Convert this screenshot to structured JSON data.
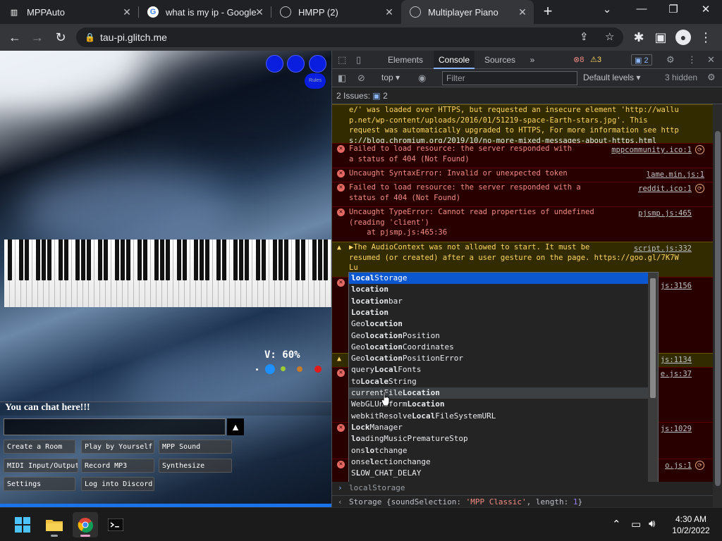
{
  "tabs": [
    {
      "title": "MPPAuto",
      "icon": "piano-icon"
    },
    {
      "title": "what is my ip - Google",
      "icon": "google-icon"
    },
    {
      "title": "HMPP (2)",
      "icon": "globe-icon"
    },
    {
      "title": "Multiplayer Piano",
      "icon": "globe-icon"
    }
  ],
  "address_bar": {
    "url": "tau-pi.glitch.me"
  },
  "app": {
    "volume": "V: 60%",
    "rules_label": "Rules",
    "chat_title": "You can chat here!!!",
    "chat_send": "▲",
    "buttons": [
      "Create a Room",
      "Play by Yourself",
      "MPP Sound",
      "MIDI Input/Output",
      "Record MP3",
      "Synthesize",
      "Settings",
      "Log into Discord"
    ]
  },
  "devtools": {
    "tabs": [
      "Elements",
      "Console",
      "Sources",
      "»"
    ],
    "error_count": "8",
    "warning_count": "3",
    "message_count": "2",
    "context": "top",
    "filter_placeholder": "Filter",
    "levels": "Default levels",
    "hidden": "3 hidden",
    "issues_label": "2 Issues:",
    "issues_count": "2",
    "messages": [
      {
        "type": "warn",
        "lines": [
          "e/' was loaded over HTTPS, but requested an insecure element 'http://wallu",
          "p.net/wp-content/uploads/2016/01/51219-space-Earth-stars.jpg'. This",
          "request was automatically upgraded to HTTPS, For more information see http",
          "s://blog.chromium.org/2019/10/no-more-mixed-messages-about-https.html"
        ],
        "source": ""
      },
      {
        "type": "err",
        "lines": [
          "Failed to load resource: the server responded with",
          "a status of 404 (Not Found)"
        ],
        "source": "mppcommunity.ico:1"
      },
      {
        "type": "err",
        "lines": [
          "Uncaught SyntaxError: Invalid or unexpected token"
        ],
        "source": "lame.min.js:1"
      },
      {
        "type": "err",
        "lines": [
          "Failed to load resource: the server responded with a",
          "status of 404 (Not Found)"
        ],
        "source": "reddit.ico:1"
      },
      {
        "type": "err",
        "lines": [
          "Uncaught TypeError: Cannot read properties of undefined",
          "(reading 'client')",
          "    at pjsmp.js:465:36"
        ],
        "source": "pjsmp.js:465"
      },
      {
        "type": "warn",
        "lines": [
          "▶The AudioContext was not allowed to start. It must be",
          "resumed (or created) after a user gesture on the page. https://goo.gl/7K7W",
          "Lu"
        ],
        "source": "script.js:332"
      },
      {
        "type": "err",
        "lines": [
          ""
        ],
        "source": "js:3156"
      },
      {
        "type": "warn",
        "lines": [
          ""
        ],
        "source": "js:1134"
      },
      {
        "type": "err",
        "lines": [
          ""
        ],
        "source": "e.js:37"
      },
      {
        "type": "err",
        "lines": [
          ""
        ],
        "source": "js:1029"
      },
      {
        "type": "err",
        "lines": [
          ""
        ],
        "source": "o.js:1"
      }
    ],
    "autocomplete": [
      {
        "bold": "local",
        "rest": "Storage"
      },
      {
        "bold": "location",
        "rest": ""
      },
      {
        "bold": "location",
        "rest": "bar"
      },
      {
        "bold": "Location",
        "rest": ""
      },
      {
        "pre": "Geo",
        "bold": "location",
        "rest": ""
      },
      {
        "pre": "Geo",
        "bold": "location",
        "rest": "Position"
      },
      {
        "pre": "Geo",
        "bold": "location",
        "rest": "Coordinates"
      },
      {
        "pre": "Geo",
        "bold": "location",
        "rest": "PositionError"
      },
      {
        "pre": "query",
        "bold": "Local",
        "rest": "Fonts"
      },
      {
        "pre": "to",
        "bold": "Locale",
        "rest": "String"
      },
      {
        "pre": "currentFile",
        "bold": "Location",
        "rest": ""
      },
      {
        "pre": "WebGLUniform",
        "bold": "Location",
        "rest": ""
      },
      {
        "pre": "webkitResolve",
        "bold": "Local",
        "rest": "FileSystemURL"
      },
      {
        "pre": "",
        "bold": "Lock",
        "rest": "Manager"
      },
      {
        "pre": "",
        "bold": "lo",
        "rest": "adingMusicPrematureStop"
      },
      {
        "pre": "ons",
        "bold": "lo",
        "rest": "tchange"
      },
      {
        "pre": "onse",
        "bold": "l",
        "rest": "ectionchange"
      },
      {
        "pre": "S",
        "bold": "L",
        "rest": "OW_CHAT_DELAY"
      }
    ],
    "prompt_input": "localStorage",
    "result_prefix": "Storage {soundSelection: ",
    "result_string": "'MPP Classic'",
    "result_mid": ", length: ",
    "result_number": "1",
    "result_suffix": "}"
  },
  "taskbar": {
    "time": "4:30 AM",
    "date": "10/2/2022"
  }
}
